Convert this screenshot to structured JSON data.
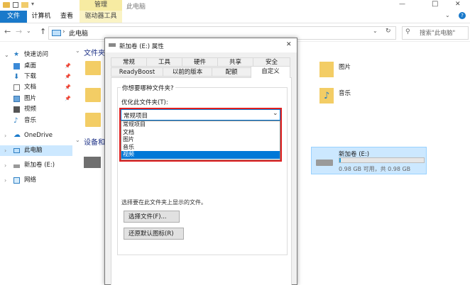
{
  "window": {
    "title": "此电脑",
    "controls": {
      "minimize": "—",
      "maximize": "□",
      "close": "✕"
    }
  },
  "ribbon": {
    "tabs": [
      "文件",
      "计算机",
      "查看"
    ],
    "context_group": "管理",
    "context_tab": "驱动器工具",
    "help": "?"
  },
  "address": {
    "path_root": "此电脑",
    "search_placeholder": "搜索\"此电脑\""
  },
  "sidebar": {
    "items": [
      {
        "label": "快速访问",
        "pinned": false
      },
      {
        "label": "桌面",
        "pinned": true
      },
      {
        "label": "下载",
        "pinned": true
      },
      {
        "label": "文档",
        "pinned": true
      },
      {
        "label": "图片",
        "pinned": true
      },
      {
        "label": "视频",
        "pinned": false
      },
      {
        "label": "音乐",
        "pinned": false
      },
      {
        "label": "OneDrive",
        "pinned": false
      },
      {
        "label": "此电脑",
        "pinned": false
      },
      {
        "label": "新加卷 (E:)",
        "pinned": false
      },
      {
        "label": "网络",
        "pinned": false
      }
    ]
  },
  "main": {
    "section_folders": "文件夹",
    "section_devices": "设备和",
    "folders": [
      {
        "label": "图片"
      },
      {
        "label": "音乐"
      }
    ],
    "drive": {
      "name": "新加卷 (E:)",
      "space": "0.98 GB 可用，共 0.98 GB",
      "used_fraction": 0.02
    }
  },
  "dialog": {
    "title": "新加卷 (E:) 属性",
    "tabs_row1": [
      "常规",
      "工具",
      "硬件",
      "共享",
      "安全"
    ],
    "tabs_row2": [
      "ReadyBoost",
      "以前的版本",
      "配额",
      "自定义"
    ],
    "active_tab": "自定义",
    "group_label": "你想要哪种文件夹?",
    "optimize_label": "优化此文件夹(T):",
    "combo_value": "常规项目",
    "options": [
      "常规项目",
      "文档",
      "图片",
      "音乐",
      "视频"
    ],
    "selected_option": "视频",
    "hidden_text": "选择要在此文件夹上显示的文件。",
    "choose_file_button": "选择文件(F)...",
    "restore_button": "还原默认图标(R)",
    "close": "✕"
  },
  "colors": {
    "accent": "#0078d7",
    "file_tab": "#1979ca",
    "highlight": "#e02020",
    "selection": "#cce8ff"
  }
}
